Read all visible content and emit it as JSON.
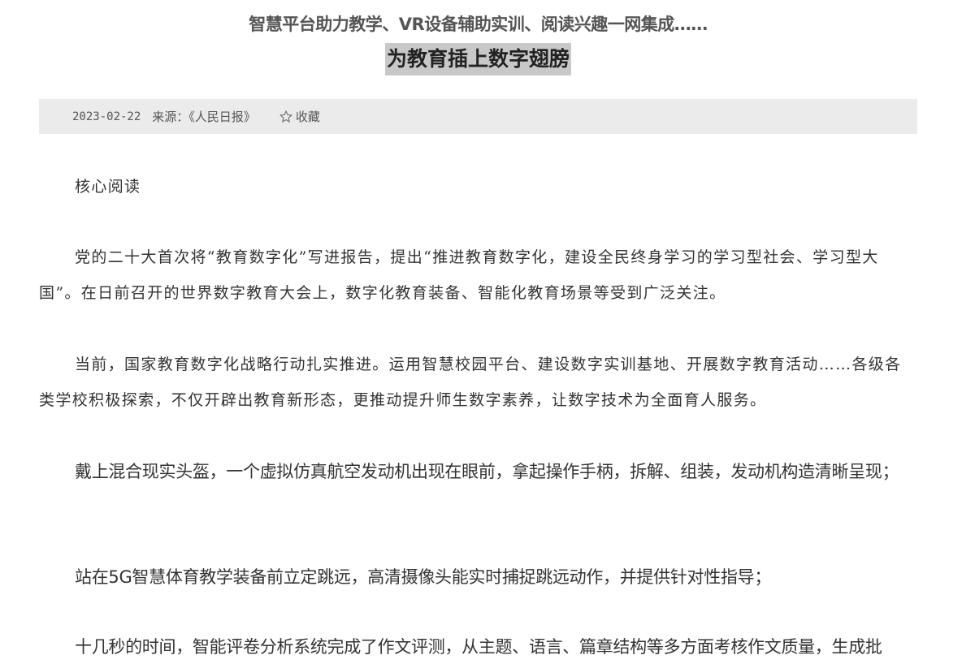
{
  "article": {
    "subtitle": "智慧平台助力教学、VR设备辅助实训、阅读兴趣一网集成……",
    "title": "为教育插上数字翅膀",
    "date": "2023-02-22",
    "source": "来源：《人民日报》",
    "favorite_label": "收藏",
    "paragraphs": [
      "核心阅读",
      "党的二十大首次将“教育数字化”写进报告，提出“推进教育数字化，建设全民终身学习的学习型社会、学习型大国”。在日前召开的世界数字教育大会上，数字化教育装备、智能化教育场景等受到广泛关注。",
      "当前，国家教育数字化战略行动扎实推进。运用智慧校园平台、建设数字实训基地、开展数字教育活动……各级各类学校积极探索，不仅开辟出教育新形态，更推动提升师生数字素养，让数字技术为全面育人服务。",
      "戴上混合现实头盔，一个虚拟仿真航空发动机出现在眼前，拿起操作手柄，拆解、组装，发动机构造清晰呈现；",
      "站在5G智慧体育教学装备前立定跳远，高清摄像头能实时捕捉跳远动作，并提供针对性指导；",
      "十几秒的时间，智能评卷分析系统完成了作文评测，从主题、语言、篇章结构等多方面考核作文质量，生成批"
    ]
  },
  "colors": {
    "meta_bar_bg": "#ebebeb",
    "title_highlight": "#c8c8c8",
    "text": "#333333"
  },
  "icons": {
    "favorite": "star-outline-icon"
  }
}
